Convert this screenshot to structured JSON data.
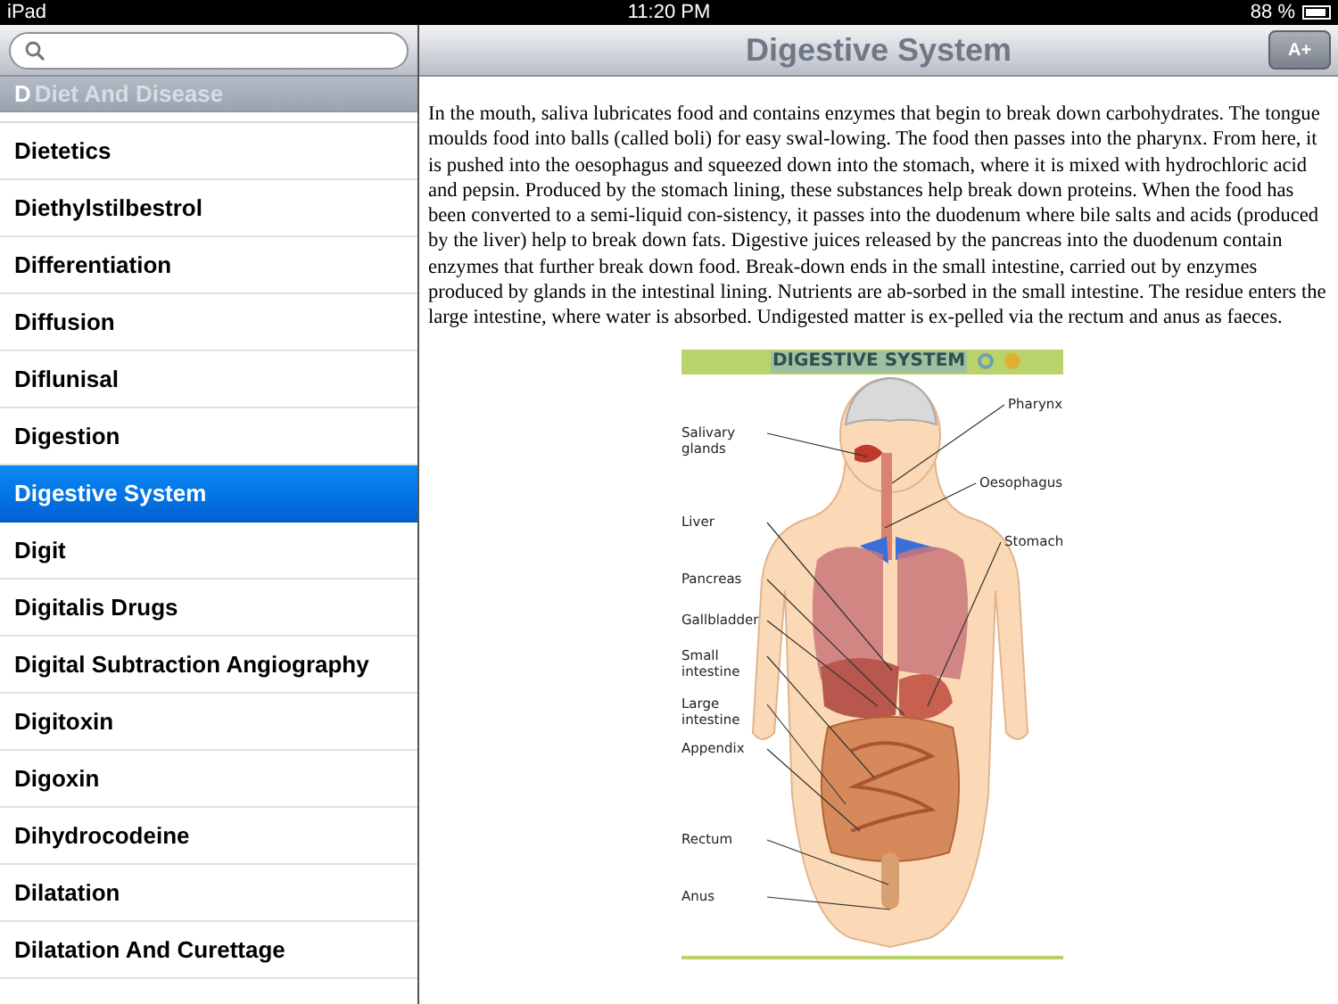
{
  "status_bar": {
    "device": "iPad",
    "time": "11:20 PM",
    "battery": "88 %"
  },
  "sidebar": {
    "section_header": {
      "index_letter": "D",
      "title": "Diet And Disease"
    },
    "items": [
      {
        "label": "Dietetics",
        "selected": false
      },
      {
        "label": "Diethylstilbestrol",
        "selected": false
      },
      {
        "label": "Differentiation",
        "selected": false
      },
      {
        "label": "Diffusion",
        "selected": false
      },
      {
        "label": "Diflunisal",
        "selected": false
      },
      {
        "label": "Digestion",
        "selected": false
      },
      {
        "label": "Digestive System",
        "selected": true
      },
      {
        "label": "Digit",
        "selected": false
      },
      {
        "label": "Digitalis Drugs",
        "selected": false
      },
      {
        "label": "Digital Subtraction Angiography",
        "selected": false
      },
      {
        "label": "Digitoxin",
        "selected": false
      },
      {
        "label": "Digoxin",
        "selected": false
      },
      {
        "label": "Dihydrocodeine",
        "selected": false
      },
      {
        "label": "Dilatation",
        "selected": false
      },
      {
        "label": "Dilatation And Curettage",
        "selected": false
      }
    ]
  },
  "article": {
    "title": "Digestive System",
    "font_button": "A+",
    "paragraph": "In the mouth, saliva lubricates food and contains enzymes that begin to break down carbohydrates. The tongue moulds food into balls (called boli) for easy swal-lowing. The food then passes into the pharynx. From here, it is pushed into the oesophagus and squeezed down into the stomach, where it is mixed with hydrochloric acid and pepsin. Produced by the stomach lining, these substances help break down proteins. When the food has been converted to a semi-liquid con-sistency, it passes into the duodenum where bile salts and acids (produced by the liver) help to break down fats. Digestive juices released by the pancreas into the duodenum contain enzymes that further break down food. Break-down ends in the small intestine, carried out by enzymes produced by glands in the intestinal lining. Nutrients are ab-sorbed in the small intestine. The residue enters the large intestine, where water is absorbed. Undigested matter is ex-pelled via the rectum and anus as faeces.",
    "figure": {
      "title": "DIGESTIVE SYSTEM",
      "labels_right": [
        "Pharynx",
        "Oesophagus",
        "Stomach"
      ],
      "labels_left": [
        "Salivary glands",
        "Liver",
        "Pancreas",
        "Gallbladder",
        "Small intestine",
        "Large intestine",
        "Appendix",
        "Rectum",
        "Anus"
      ]
    }
  }
}
